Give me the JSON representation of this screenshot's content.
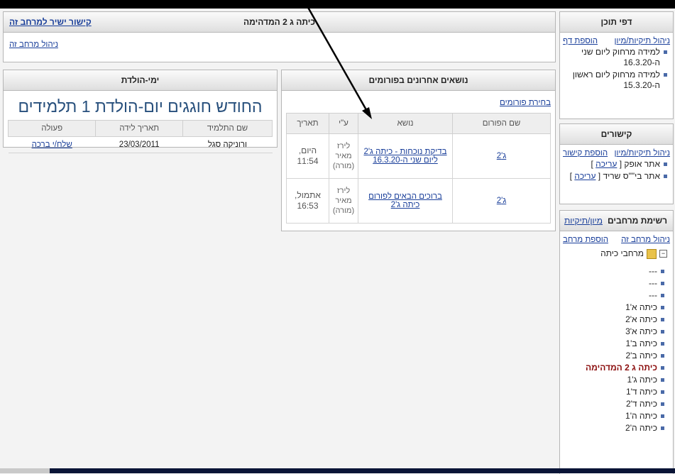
{
  "content_pages": {
    "title": "דפי תוכן",
    "manage": "ניהול תיקיות/מיון",
    "add": "הוספת דף",
    "items": [
      "למידה מרחוק ליום שני ה-16.3.20",
      "למידה מרחוק ליום ראשון ה-15.3.20"
    ]
  },
  "links": {
    "title": "קישורים",
    "manage": "ניהול תיקיות/מיון",
    "add": "הוספת קישור",
    "items": [
      {
        "label": "אתר אופק",
        "edit": "עריכה"
      },
      {
        "label": "אתר בי\"\"ס שריד",
        "edit": "עריכה"
      }
    ]
  },
  "spaces": {
    "title": "רשימת מרחבים",
    "sort": "מיון/תיקיות",
    "add": "הוספת מרחב",
    "manage": "ניהול מרחב זה",
    "folder_label": "מרחבי כיתה",
    "expand_glyph": "−",
    "items": [
      "---",
      "---",
      "---",
      "כיתה א'1",
      "כיתה א'2",
      "כיתה א'3",
      "כיתה ב'1",
      "כיתה ב'2",
      "כיתה ג 2 המדהימה",
      "כיתה ג'1",
      "כיתה ד'1",
      "כיתה ד'2",
      "כיתה ה'1",
      "כיתה ה'2"
    ],
    "current_index": 8
  },
  "top": {
    "title": "כיתה ג 2 המדהימה",
    "direct_link": "קישור ישיר למרחב זה",
    "manage": "ניהול מרחב זה"
  },
  "forums": {
    "title": "נושאים אחרונים בפורומים",
    "choose": "בחירת פורומים",
    "columns": [
      "שם הפורום",
      "נושא",
      "ע\"י",
      "תאריך"
    ],
    "rows": [
      {
        "forum": "ג'2",
        "topic": "בדיקת נוכחות - כיתה ג'2 ליום שני ה-16.3.20",
        "by": "לירז מאיר (מורה)",
        "date": "היום, 11:54"
      },
      {
        "forum": "ג'2",
        "topic": "ברוכים הבאים לפורום כיתה ג'2",
        "by": "לירז מאיר (מורה)",
        "date": "אתמול, 16:53"
      }
    ]
  },
  "birthdays": {
    "title": "ימי-הולדת",
    "headline": "החודש חוגגים יום-הולדת 1 תלמידים",
    "columns": [
      "שם התלמיד",
      "תאריך לידה",
      "פעולה"
    ],
    "rows": [
      {
        "name": "ורוניקה סגל",
        "date": "23/03/2011",
        "action": "שלח/י ברכה"
      }
    ]
  }
}
